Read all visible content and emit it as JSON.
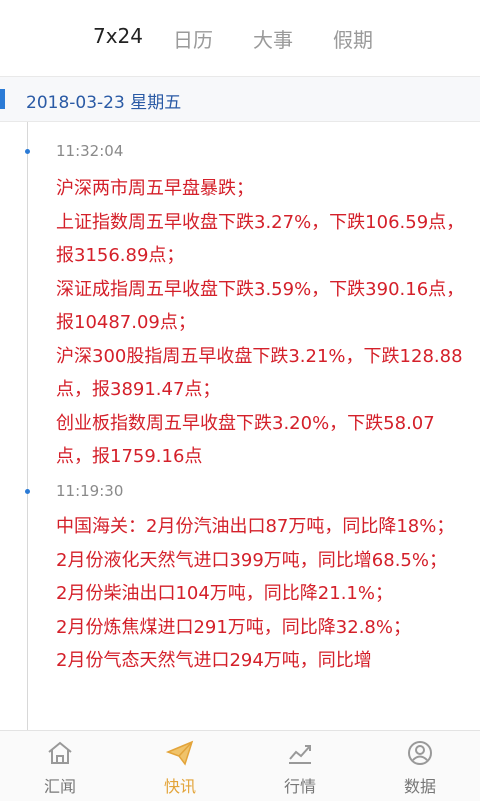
{
  "top_tabs": [
    {
      "label": "7x24",
      "active": true
    },
    {
      "label": "日历",
      "active": false
    },
    {
      "label": "大事",
      "active": false
    },
    {
      "label": "假期",
      "active": false
    }
  ],
  "date_header": "2018-03-23 星期五",
  "feed": [
    {
      "time": "11:32:04",
      "lines": [
        "沪深两市周五早盘暴跌；",
        "上证指数周五早收盘下跌3.27%，下跌106.59点，报3156.89点；",
        "深证成指周五早收盘下跌3.59%，下跌390.16点，报10487.09点；",
        "沪深300股指周五早收盘下跌3.21%，下跌128.88点，报3891.47点；",
        "创业板指数周五早收盘下跌3.20%，下跌58.07点，报1759.16点"
      ]
    },
    {
      "time": "11:19:30",
      "lines": [
        "中国海关：2月份汽油出口87万吨，同比降18%；",
        "2月份液化天然气进口399万吨，同比增68.5%；",
        "2月份柴油出口104万吨，同比降21.1%；",
        "2月份炼焦煤进口291万吨，同比降32.8%；",
        "2月份气态天然气进口294万吨，同比增"
      ]
    }
  ],
  "bottom_nav": [
    {
      "label": "汇闻",
      "icon": "home-icon",
      "active": false
    },
    {
      "label": "快讯",
      "icon": "paper-plane-icon",
      "active": true
    },
    {
      "label": "行情",
      "icon": "trend-chart-icon",
      "active": false
    },
    {
      "label": "数据",
      "icon": "user-circle-icon",
      "active": false
    }
  ],
  "colors": {
    "accent_blue": "#2b7bd6",
    "news_red": "#d4202a",
    "active_nav": "#e3a43a"
  }
}
